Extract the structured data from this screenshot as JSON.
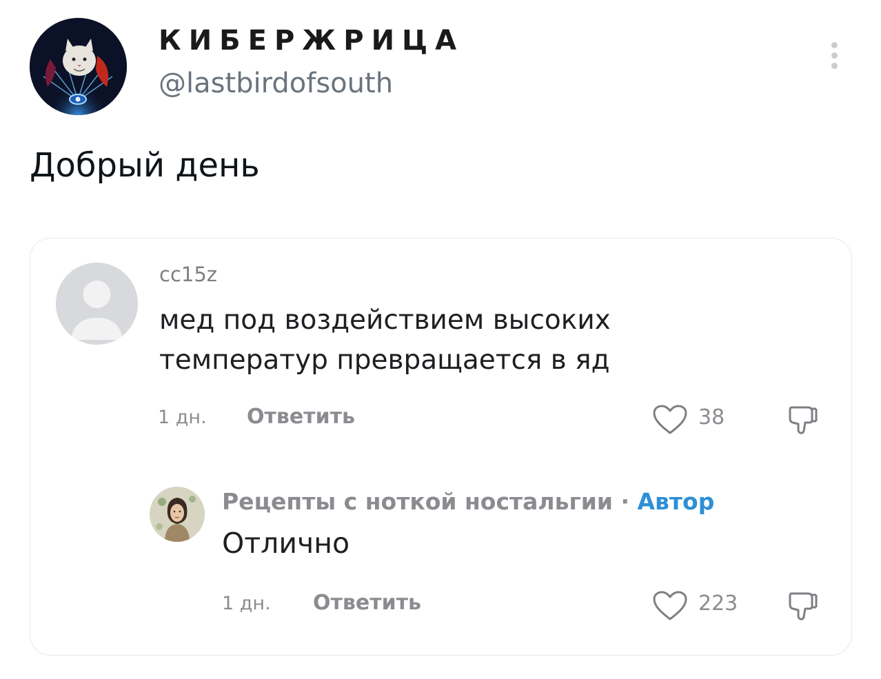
{
  "tweet": {
    "author": {
      "display_name": "КИБЕРЖРИЦА",
      "handle": "@lastbirdofsouth",
      "avatar_icon": "cat-avatar"
    },
    "more_icon": "more-vertical-icon",
    "text": "Добрый день"
  },
  "embedded_comments": [
    {
      "username": "cc15z",
      "avatar_icon": "default-user-avatar",
      "text": "мед под воздействием высоких температур превращается в яд",
      "time": "1 дн.",
      "reply_label": "Ответить",
      "likes": "38",
      "like_icon": "heart-icon",
      "dislike_icon": "thumbs-down-icon"
    },
    {
      "username": "Рецепты с ноткой ностальгии",
      "separator": " · ",
      "author_badge": "Автор",
      "avatar_icon": "woman-portrait-avatar",
      "text": "Отлично",
      "time": "1 дн.",
      "reply_label": "Ответить",
      "likes": "223",
      "like_icon": "heart-icon",
      "dislike_icon": "thumbs-down-icon"
    }
  ],
  "colors": {
    "text_primary": "#0f1419",
    "handle_gray": "#6a737d",
    "comment_meta_gray": "#8a8c90",
    "author_badge_blue": "#2d8fd8",
    "card_border": "#e6e8eb"
  }
}
